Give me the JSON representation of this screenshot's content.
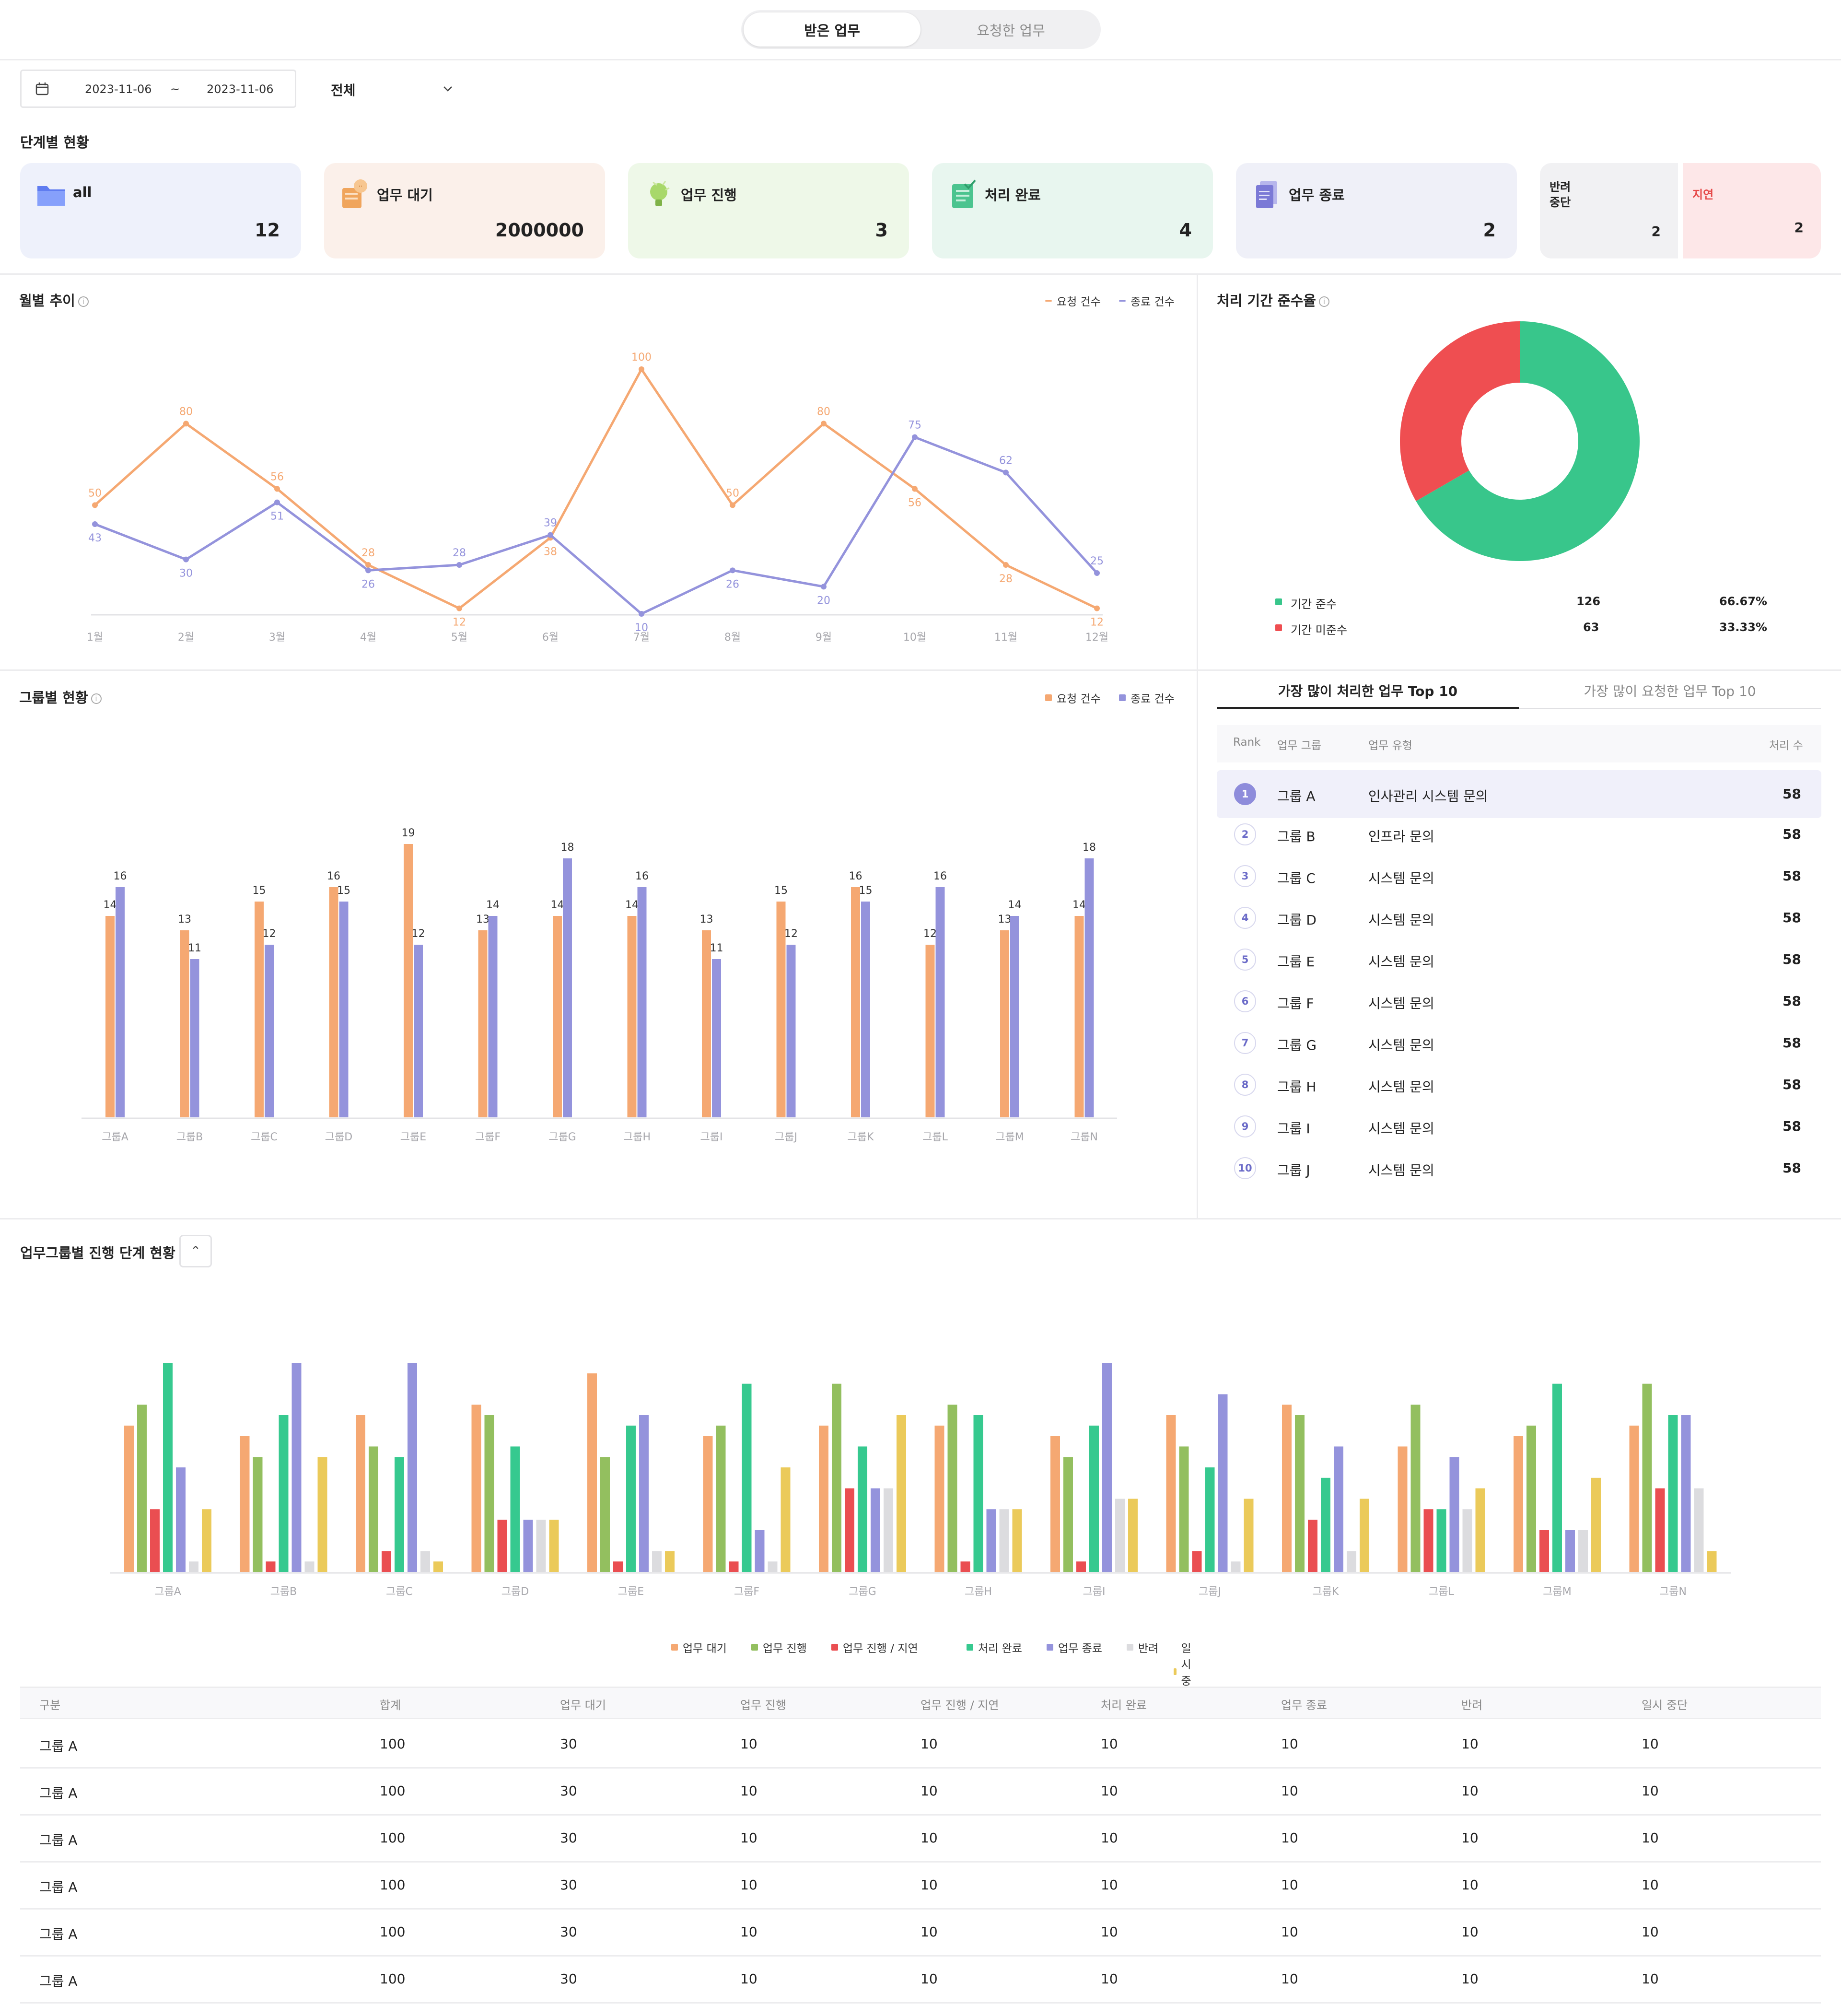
{
  "tabs": {
    "received": "받은 업무",
    "requested": "요청한 업무"
  },
  "filter": {
    "date_from": "2023-11-06",
    "tilde": "~",
    "date_to": "2023-11-06",
    "select_value": "전체"
  },
  "stage": {
    "title": "단계별 현황",
    "cards": [
      {
        "label": "all",
        "value": "12",
        "bg": "#eef1fb",
        "icon": "folder-icon"
      },
      {
        "label": "업무 대기",
        "value": "2000000",
        "bg": "#fbf0ea",
        "icon": "waiting-doc-icon"
      },
      {
        "label": "업무 진행",
        "value": "3",
        "bg": "#eef8e8",
        "icon": "lightbulb-icon"
      },
      {
        "label": "처리 완료",
        "value": "4",
        "bg": "#e8f6ef",
        "icon": "checklist-icon"
      },
      {
        "label": "업무 종료",
        "value": "2",
        "bg": "#eff0f8",
        "icon": "document-icon"
      }
    ],
    "split": {
      "left_label_1": "반려",
      "left_label_2": "중단",
      "left_value": "2",
      "right_label": "지연",
      "right_value": "2"
    }
  },
  "monthly": {
    "title": "월별 추이",
    "info": "i",
    "legend": [
      "요청 건수",
      "종료 건수"
    ]
  },
  "compliance": {
    "title": "처리 기간 준수율",
    "info": "i",
    "rows": [
      {
        "label": "기간 준수",
        "count": "126",
        "pct": "66.67%",
        "color": "#38c68b"
      },
      {
        "label": "기간 미준수",
        "count": "63",
        "pct": "33.33%",
        "color": "#ef4e51"
      }
    ]
  },
  "group": {
    "title": "그룹별 현황",
    "info": "i",
    "legend": [
      "요청 건수",
      "종료 건수"
    ]
  },
  "top10": {
    "tab_processed": "가장 많이 처리한 업무 Top 10",
    "tab_requested": "가장 많이 요청한 업무 Top 10",
    "headers": {
      "rank": "Rank",
      "group": "업무 그룹",
      "type": "업무 유형",
      "count": "처리 수"
    },
    "rows": [
      {
        "rank": "1",
        "group": "그룹 A",
        "type": "인사관리 시스템 문의",
        "count": "58"
      },
      {
        "rank": "2",
        "group": "그룹 B",
        "type": "인프라 문의",
        "count": "58"
      },
      {
        "rank": "3",
        "group": "그룹 C",
        "type": "시스템 문의",
        "count": "58"
      },
      {
        "rank": "4",
        "group": "그룹 D",
        "type": "시스템 문의",
        "count": "58"
      },
      {
        "rank": "5",
        "group": "그룹 E",
        "type": "시스템 문의",
        "count": "58"
      },
      {
        "rank": "6",
        "group": "그룹 F",
        "type": "시스템 문의",
        "count": "58"
      },
      {
        "rank": "7",
        "group": "그룹 G",
        "type": "시스템 문의",
        "count": "58"
      },
      {
        "rank": "8",
        "group": "그룹 H",
        "type": "시스템 문의",
        "count": "58"
      },
      {
        "rank": "9",
        "group": "그룹 I",
        "type": "시스템 문의",
        "count": "58"
      },
      {
        "rank": "10",
        "group": "그룹 J",
        "type": "시스템 문의",
        "count": "58"
      }
    ]
  },
  "progress": {
    "title": "업무그룹별 진행 단계 현황",
    "collapse_glyph": "⌃"
  },
  "table": {
    "headers": [
      "구분",
      "합계",
      "업무 대기",
      "업무 진행",
      "업무 진행 / 지연",
      "처리 완료",
      "업무 종료",
      "반려",
      "일시 중단"
    ],
    "rows": [
      [
        "그룹 A",
        "100",
        "30",
        "10",
        "10",
        "10",
        "10",
        "10",
        "10"
      ],
      [
        "그룹 A",
        "100",
        "30",
        "10",
        "10",
        "10",
        "10",
        "10",
        "10"
      ],
      [
        "그룹 A",
        "100",
        "30",
        "10",
        "10",
        "10",
        "10",
        "10",
        "10"
      ],
      [
        "그룹 A",
        "100",
        "30",
        "10",
        "10",
        "10",
        "10",
        "10",
        "10"
      ],
      [
        "그룹 A",
        "100",
        "30",
        "10",
        "10",
        "10",
        "10",
        "10",
        "10"
      ],
      [
        "그룹 A",
        "100",
        "30",
        "10",
        "10",
        "10",
        "10",
        "10",
        "10"
      ]
    ]
  },
  "colors": {
    "orange": "#f5a872",
    "purple": "#9493dc",
    "green_donut": "#38c68b",
    "red_donut": "#ef4e51",
    "stage": [
      "#f5a872",
      "#93bf5f",
      "#ea4e51",
      "#36c98f",
      "#9493dc",
      "#dcdcdf",
      "#ebca5a"
    ]
  },
  "chart_data": [
    {
      "type": "line",
      "x": [
        "1월",
        "2월",
        "3월",
        "4월",
        "5월",
        "6월",
        "7월",
        "8월",
        "9월",
        "10월",
        "11월",
        "12월"
      ],
      "series": [
        {
          "name": "요청 건수",
          "values": [
            50,
            80,
            56,
            28,
            12,
            38,
            100,
            50,
            80,
            56,
            28,
            12
          ]
        },
        {
          "name": "종료 건수",
          "values": [
            43,
            30,
            51,
            26,
            28,
            39,
            10,
            26,
            20,
            75,
            62,
            25
          ]
        }
      ],
      "ylim": [
        10,
        100
      ]
    },
    {
      "type": "pie",
      "labels": [
        "기간 준수",
        "기간 미준수"
      ],
      "values": [
        126,
        63
      ]
    },
    {
      "type": "bar",
      "categories": [
        "그룹A",
        "그룹B",
        "그룹C",
        "그룹D",
        "그룹E",
        "그룹F",
        "그룹G",
        "그룹H",
        "그룹I",
        "그룹J",
        "그룹K",
        "그룹L",
        "그룹M",
        "그룹N"
      ],
      "series": [
        {
          "name": "요청 건수",
          "values": [
            14,
            13,
            15,
            16,
            19,
            13,
            14,
            14,
            13,
            15,
            16,
            12,
            13,
            14
          ]
        },
        {
          "name": "종료 건수",
          "values": [
            16,
            11,
            12,
            15,
            12,
            14,
            18,
            16,
            11,
            12,
            15,
            16,
            14,
            18
          ]
        }
      ],
      "ylim": [
        0,
        20
      ]
    },
    {
      "type": "bar",
      "categories": [
        "그룹A",
        "그룹B",
        "그룹C",
        "그룹D",
        "그룹E",
        "그룹F",
        "그룹G",
        "그룹H",
        "그룹I",
        "그룹J",
        "그룹K",
        "그룹L",
        "그룹M",
        "그룹N"
      ],
      "series": [
        {
          "name": "업무 대기",
          "values": [
            14,
            13,
            15,
            16,
            19,
            13,
            14,
            14,
            13,
            15,
            16,
            12,
            13,
            14
          ]
        },
        {
          "name": "업무 진행",
          "values": [
            16,
            11,
            12,
            15,
            11,
            14,
            18,
            16,
            11,
            12,
            15,
            16,
            14,
            18
          ]
        },
        {
          "name": "업무 진행 / 지연",
          "values": [
            6,
            1,
            2,
            5,
            1,
            1,
            8,
            1,
            1,
            2,
            5,
            6,
            4,
            8
          ]
        },
        {
          "name": "처리 완료",
          "values": [
            20,
            15,
            11,
            12,
            14,
            18,
            12,
            15,
            14,
            10,
            9,
            6,
            18,
            15
          ]
        },
        {
          "name": "업무 종료",
          "values": [
            10,
            20,
            20,
            5,
            15,
            4,
            8,
            6,
            20,
            17,
            12,
            11,
            4,
            15
          ]
        },
        {
          "name": "반려",
          "values": [
            1,
            1,
            2,
            5,
            2,
            1,
            8,
            6,
            7,
            1,
            2,
            6,
            4,
            8
          ]
        },
        {
          "name": "일시 중단",
          "values": [
            6,
            11,
            1,
            5,
            2,
            10,
            15,
            6,
            7,
            7,
            7,
            8,
            9,
            2
          ]
        }
      ],
      "ylim": [
        0,
        20
      ]
    }
  ]
}
